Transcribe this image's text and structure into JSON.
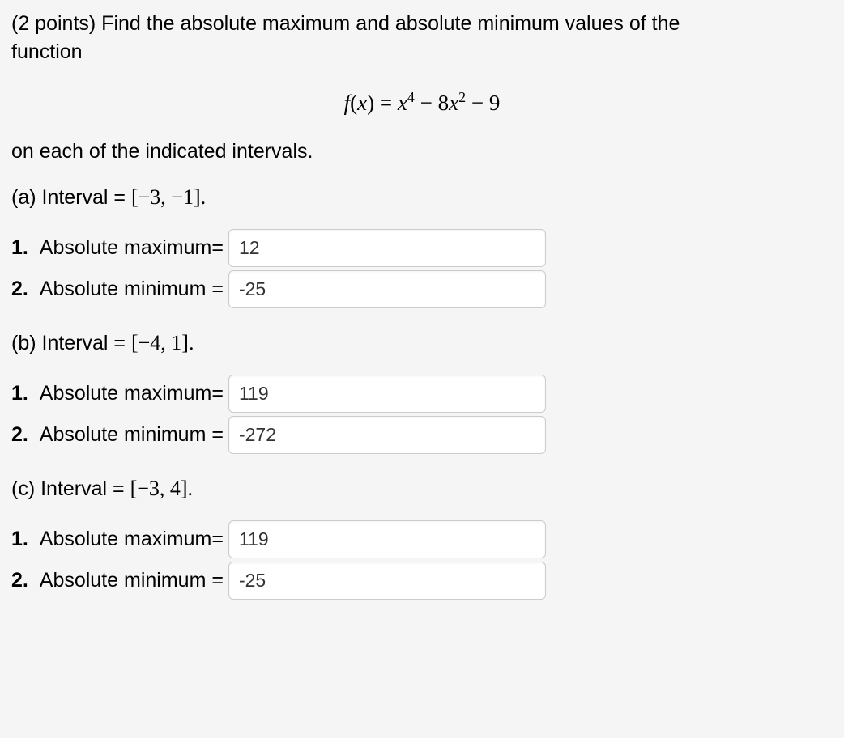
{
  "problem": {
    "points": "(2 points)",
    "text1": "Find the absolute maximum and absolute minimum values of the",
    "text2": "function",
    "equation_rendered": "f(x) = x⁴ − 8x² − 9",
    "text3": "on each of the indicated intervals."
  },
  "intervals": [
    {
      "label_prefix": "(a) Interval = ",
      "interval": "[−3, −1].",
      "answers": [
        {
          "num": "1.",
          "label": "Absolute maximum=",
          "value": "12"
        },
        {
          "num": "2.",
          "label": "Absolute minimum =",
          "value": "-25"
        }
      ]
    },
    {
      "label_prefix": "(b) Interval = ",
      "interval": "[−4, 1].",
      "answers": [
        {
          "num": "1.",
          "label": "Absolute maximum=",
          "value": "119"
        },
        {
          "num": "2.",
          "label": "Absolute minimum =",
          "value": "-272"
        }
      ]
    },
    {
      "label_prefix": "(c) Interval = ",
      "interval": "[−3, 4].",
      "answers": [
        {
          "num": "1.",
          "label": "Absolute maximum=",
          "value": "119"
        },
        {
          "num": "2.",
          "label": "Absolute minimum =",
          "value": "-25"
        }
      ]
    }
  ]
}
